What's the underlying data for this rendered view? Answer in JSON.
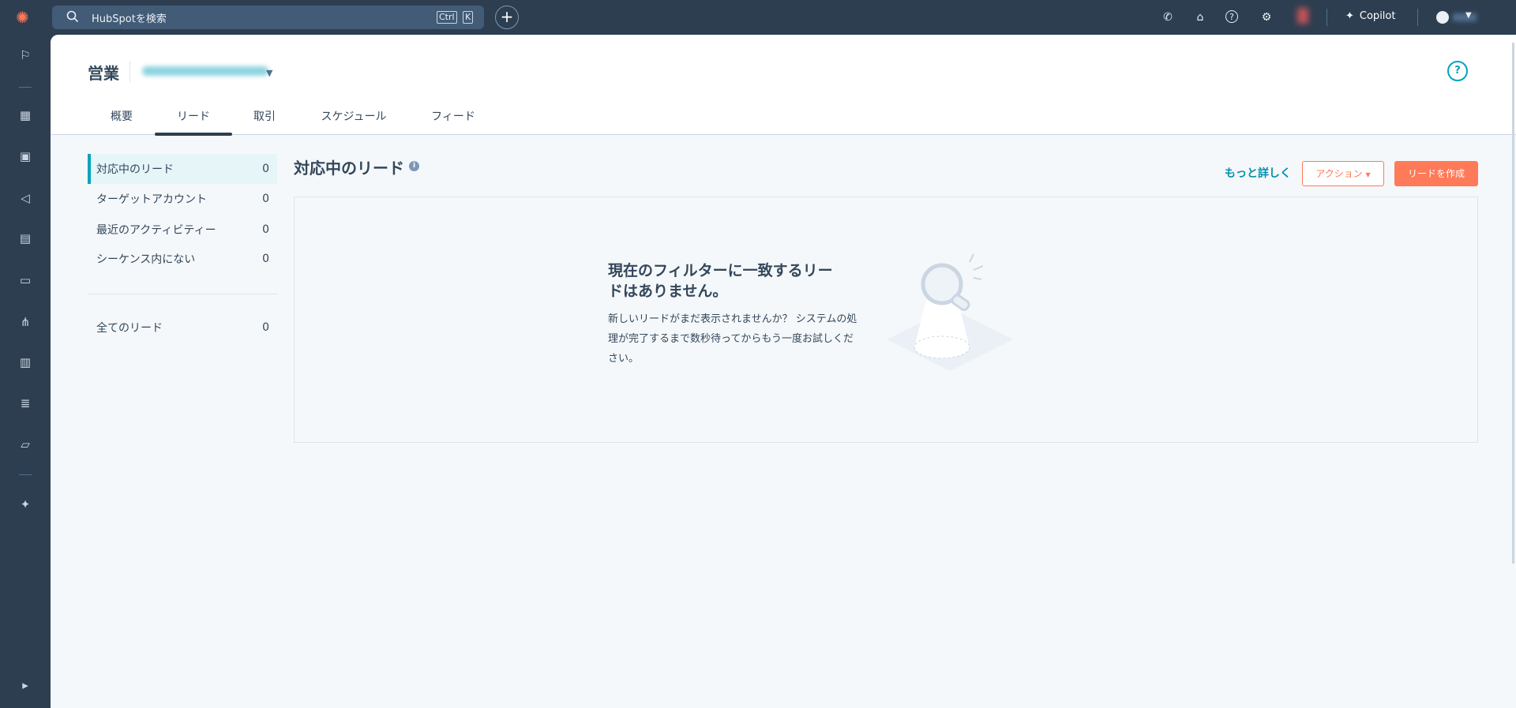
{
  "topbar": {
    "search_placeholder": "HubSpotを検索",
    "shortcut_ctrl": "Ctrl",
    "shortcut_k": "K",
    "copilot_label": "Copilot",
    "icons": [
      "phone-icon",
      "marketplace-icon",
      "help-icon",
      "settings-icon"
    ]
  },
  "header": {
    "title": "営業",
    "help": "?",
    "tabs": [
      {
        "label": "概要"
      },
      {
        "label": "リード",
        "active": true
      },
      {
        "label": "取引"
      },
      {
        "label": "スケジュール"
      },
      {
        "label": "フィード"
      }
    ]
  },
  "views": [
    {
      "label": "対応中のリード",
      "count": "0"
    },
    {
      "label": "ターゲットアカウント",
      "count": "0"
    },
    {
      "label": "最近のアクティビティー",
      "count": "0"
    },
    {
      "label": "シーケンス内にない",
      "count": "0"
    },
    {
      "label": "全てのリード",
      "count": "0"
    }
  ],
  "section": {
    "title": "対応中のリード",
    "learn_more": "もっと詳しく",
    "actions": "アクション",
    "create": "リードを作成"
  },
  "empty": {
    "heading": "現在のフィルターに一致するリードはありません。",
    "body": "新しいリードがまだ表示されませんか？ システムの処理が完了するまで数秒待ってからもう一度お試しください。"
  },
  "colors": {
    "nav": "#2d3e50",
    "accent": "#00a4bd",
    "primary": "#ff7a59"
  }
}
